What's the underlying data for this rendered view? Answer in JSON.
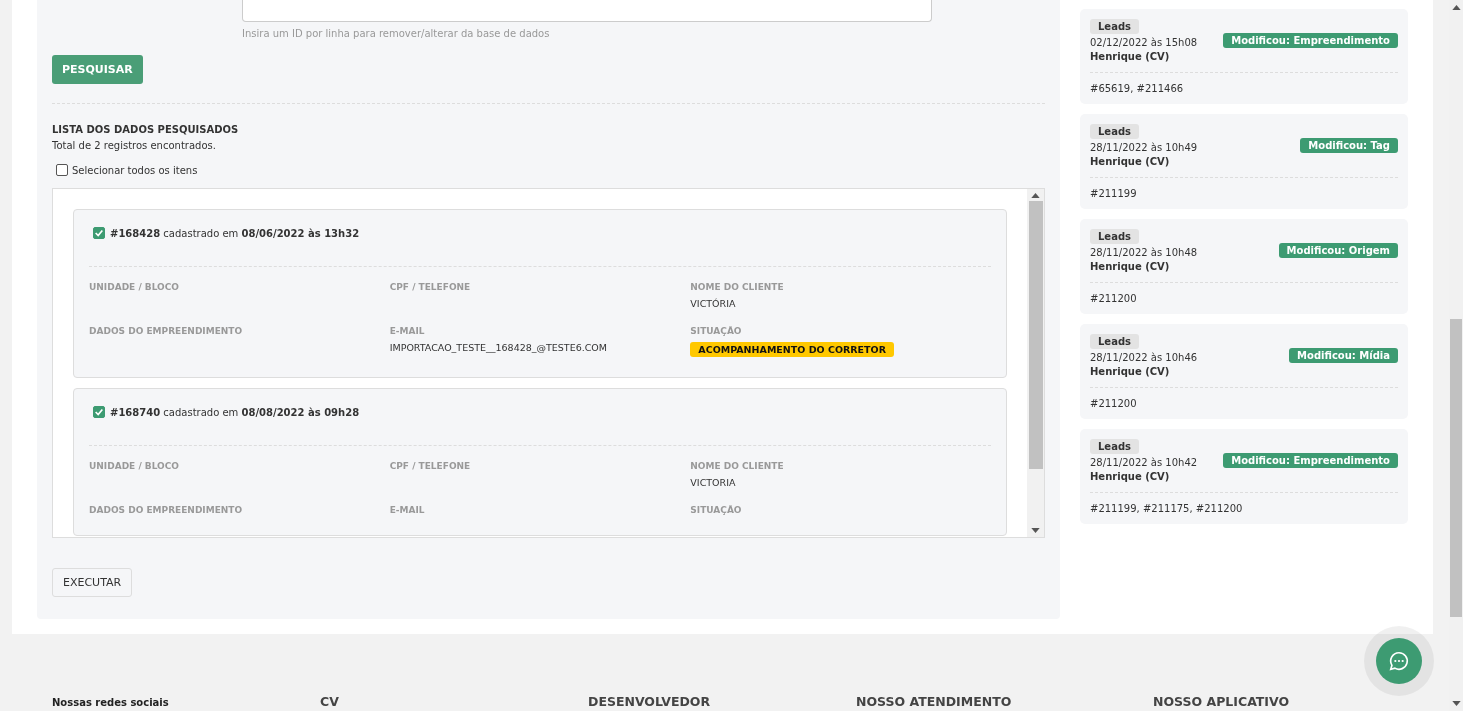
{
  "search": {
    "hint": "Insira um ID por linha para remover/alterar da base de dados",
    "button": "PESQUISAR"
  },
  "results": {
    "title": "LISTA DOS DADOS PESQUISADOS",
    "total": "Total de 2 registros encontrados.",
    "select_all": {
      "label": "Selecionar todos os itens",
      "checked": false
    },
    "records": [
      {
        "id": "#168428",
        "registered": "cadastrado em",
        "date": "08/06/2022 às 13h32",
        "checked": true,
        "fields": [
          {
            "label": "UNIDADE / BLOCO"
          },
          {
            "label": "CPF / TELEFONE"
          },
          {
            "label": "NOME DO CLIENTE",
            "value": "VICTÓRIA"
          },
          {
            "label": "DADOS DO EMPREENDIMENTO"
          },
          {
            "label": "E-MAIL",
            "value": "IMPORTACAO_TESTE__168428_@TESTE6.COM"
          },
          {
            "label": "SITUAÇÃO",
            "status": "ACOMPANHAMENTO DO CORRETOR"
          }
        ]
      },
      {
        "id": "#168740",
        "registered": "cadastrado em",
        "date": "08/08/2022 às 09h28",
        "checked": true,
        "fields": [
          {
            "label": "UNIDADE / BLOCO"
          },
          {
            "label": "CPF / TELEFONE"
          },
          {
            "label": "NOME DO CLIENTE",
            "value": "VICTORIA"
          },
          {
            "label": "DADOS DO EMPREENDIMENTO"
          },
          {
            "label": "E-MAIL"
          },
          {
            "label": "SITUAÇÃO"
          }
        ]
      }
    ]
  },
  "execute_button": "EXECUTAR",
  "history": [
    {
      "module": "Leads",
      "date": "02/12/2022 às 15h08",
      "user": "Henrique (CV)",
      "action": "Modificou: Empreendimento",
      "ids": "#65619, #211466"
    },
    {
      "module": "Leads",
      "date": "28/11/2022 às 10h49",
      "user": "Henrique (CV)",
      "action": "Modificou: Tag",
      "ids": "#211199"
    },
    {
      "module": "Leads",
      "date": "28/11/2022 às 10h48",
      "user": "Henrique (CV)",
      "action": "Modificou: Origem",
      "ids": "#211200"
    },
    {
      "module": "Leads",
      "date": "28/11/2022 às 10h46",
      "user": "Henrique (CV)",
      "action": "Modificou: Mídia",
      "ids": "#211200"
    },
    {
      "module": "Leads",
      "date": "28/11/2022 às 10h42",
      "user": "Henrique (CV)",
      "action": "Modificou: Empreendimento",
      "ids": "#211199, #211175, #211200"
    }
  ],
  "footer": {
    "columns": [
      {
        "title": "Nossas redes sociais",
        "kind": "small"
      },
      {
        "title": "CV",
        "kind": "heading"
      },
      {
        "title": "DESENVOLVEDOR",
        "kind": "heading"
      },
      {
        "title": "NOSSO ATENDIMENTO",
        "kind": "heading"
      },
      {
        "title": "NOSSO APLICATIVO",
        "kind": "heading"
      }
    ]
  }
}
